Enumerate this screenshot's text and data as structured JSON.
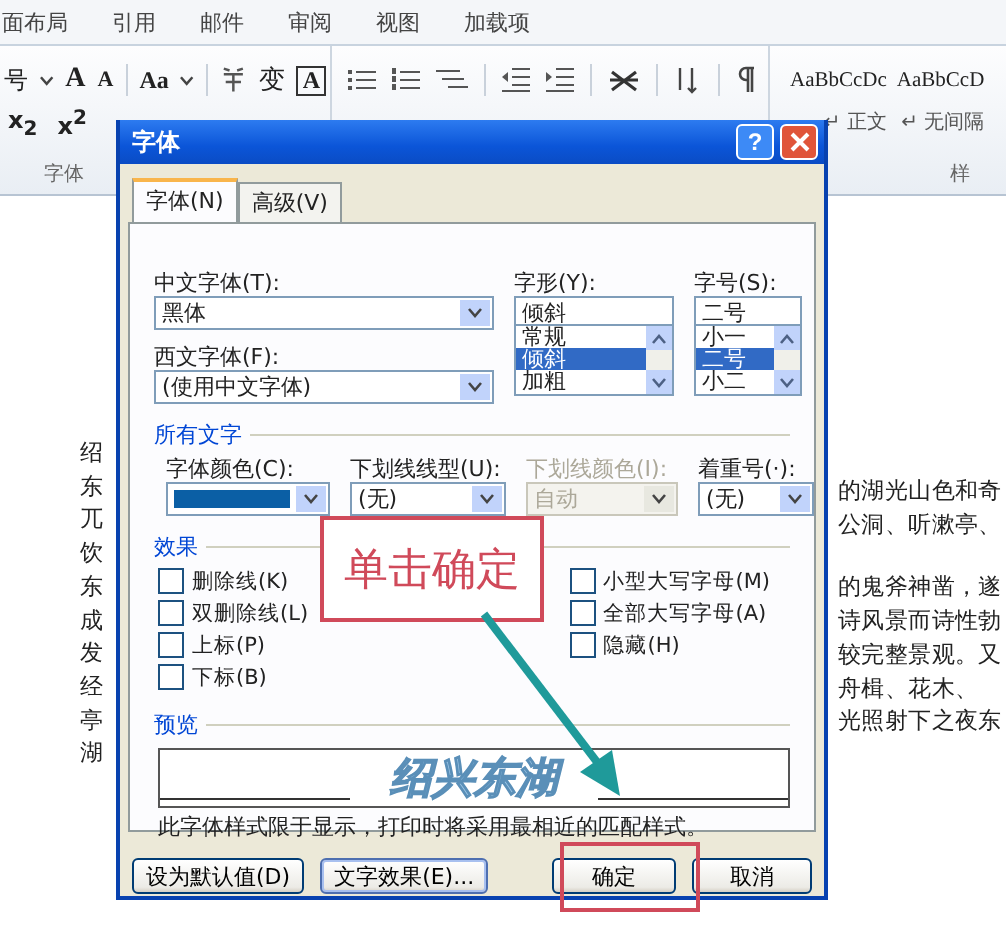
{
  "ribbon_tabs": [
    "面布局",
    "引用",
    "邮件",
    "审阅",
    "视图",
    "加载项"
  ],
  "toolbar": {
    "font_size_cut": "号",
    "grow_font": "A",
    "shrink_font": "A",
    "change_case": "Aa",
    "char_shading": "变",
    "char_border": "A",
    "subscript": "x$_{2}$",
    "superscript": "x$^{2}$"
  },
  "styles": [
    {
      "sample": "AaBbCcDc",
      "label": "↵ 正文"
    },
    {
      "sample": "AaBbCcD",
      "label": "↵ 无间隔"
    }
  ],
  "group_labels": {
    "font": "字体",
    "styles": "样"
  },
  "document": {
    "left_column": [
      "绍",
      "东",
      "兀",
      "饮",
      "东",
      "成",
      "发",
      "经",
      "亭",
      "湖"
    ],
    "right_paragraphs": [
      [
        "的湖光山色和奇",
        "公洞、听漱亭、"
      ],
      [
        "的鬼斧神凿，遂",
        "诗风景而诗性勃",
        "较完整景观。又",
        "舟楫、花木、",
        "光照射下之夜东"
      ]
    ]
  },
  "dialog": {
    "title": "字体",
    "help": "?",
    "tabs": [
      {
        "label": "字体(N)",
        "selected": true
      },
      {
        "label": "高级(V)",
        "selected": false
      }
    ],
    "chinese_font": {
      "label": "中文字体(T):",
      "value": "黑体"
    },
    "western_font": {
      "label": "西文字体(F):",
      "value": "(使用中文字体)"
    },
    "font_style": {
      "label": "字形(Y):",
      "value": "倾斜",
      "options": [
        {
          "label": "常规",
          "selected": false
        },
        {
          "label": "倾斜",
          "selected": true
        },
        {
          "label": "加粗",
          "selected": false
        }
      ]
    },
    "font_size": {
      "label": "字号(S):",
      "value": "二号",
      "options": [
        {
          "label": "小一",
          "selected": false
        },
        {
          "label": "二号",
          "selected": true
        },
        {
          "label": "小二",
          "selected": false
        }
      ]
    },
    "all_text": {
      "heading": "所有文字",
      "fields": [
        {
          "kind": "color",
          "label": "字体颜色(C):",
          "color": "#0b5fa5"
        },
        {
          "kind": "select",
          "label": "下划线线型(U):",
          "value": "(无)",
          "disabled": false
        },
        {
          "kind": "select",
          "label": "下划线颜色(I):",
          "value": "自动",
          "disabled": true
        },
        {
          "kind": "select",
          "label": "着重号(·):",
          "value": "(无)",
          "disabled": false
        }
      ]
    },
    "effects": {
      "heading": "效果",
      "left": [
        {
          "label": "删除线(K)",
          "checked": false
        },
        {
          "label": "双删除线(L)",
          "checked": false
        },
        {
          "label": "上标(P)",
          "checked": false
        },
        {
          "label": "下标(B)",
          "checked": false
        }
      ],
      "right": [
        {
          "label": "小型大写字母(M)",
          "checked": false
        },
        {
          "label": "全部大写字母(A)",
          "checked": false
        },
        {
          "label": "隐藏(H)",
          "checked": false
        }
      ]
    },
    "preview": {
      "heading": "预览",
      "sample": "绍兴东湖",
      "note": "此字体样式限于显示，打印时将采用最相近的匹配样式。"
    },
    "buttons": {
      "set_default": "设为默认值(D)",
      "text_effects": "文字效果(E)...",
      "ok": "确定",
      "cancel": "取消"
    }
  },
  "annotation": {
    "callout": "单击确定"
  }
}
